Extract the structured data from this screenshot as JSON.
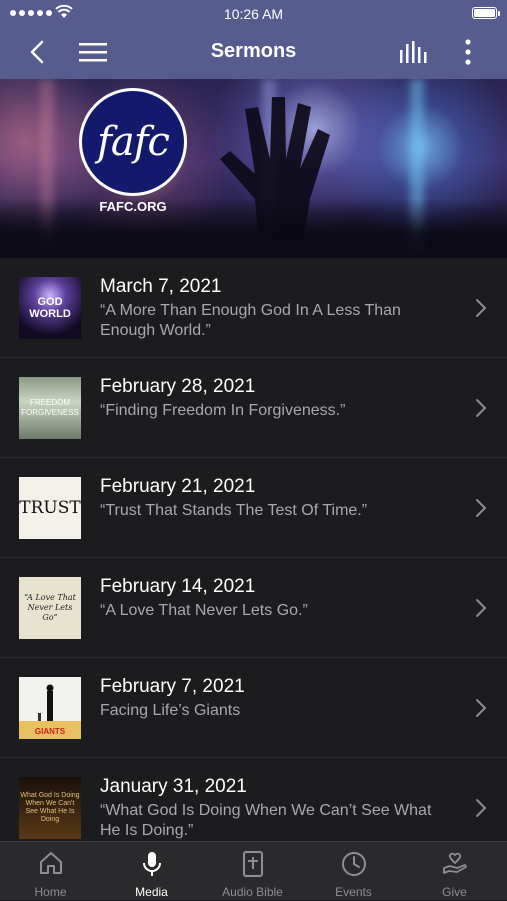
{
  "status_bar": {
    "time": "10:26 AM"
  },
  "nav": {
    "title": "Sermons",
    "back_icon": "chevron-left-icon",
    "menu_icon": "hamburger-icon",
    "audio_icon": "equalizer-icon",
    "more_icon": "vertical-ellipsis-icon"
  },
  "hero": {
    "logo_text": "fafc",
    "logo_url": "FAFC.ORG"
  },
  "sermons": [
    {
      "date": "March 7, 2021",
      "title": "“A More Than Enough God In A Less Than Enough World.”",
      "thumb_text": "GOD WORLD"
    },
    {
      "date": "February 28, 2021",
      "title": "“Finding Freedom In Forgiveness.”",
      "thumb_text": "FREEDOM FORGIVENESS"
    },
    {
      "date": "February 21, 2021",
      "title": "“Trust That Stands The Test Of Time.”",
      "thumb_text": "TRUST"
    },
    {
      "date": "February 14, 2021",
      "title": "“A Love That Never Lets Go.”",
      "thumb_text": "“A Love That Never Lets Go”"
    },
    {
      "date": "February 7, 2021",
      "title": "Facing Life’s Giants",
      "thumb_text": "GIANTS"
    },
    {
      "date": "January 31, 2021",
      "title": "“What God Is Doing When We Can’t See What He Is Doing.”",
      "thumb_text": "What God Is Doing When We Can't See What He Is Doing"
    }
  ],
  "tabs": [
    {
      "label": "Home",
      "icon": "home-icon"
    },
    {
      "label": "Media",
      "icon": "microphone-icon",
      "active": true
    },
    {
      "label": "Audio Bible",
      "icon": "bible-icon"
    },
    {
      "label": "Events",
      "icon": "clock-icon"
    },
    {
      "label": "Give",
      "icon": "hand-heart-icon"
    }
  ],
  "colors": {
    "header": "#575c8f",
    "background": "#1c1c1e",
    "tabbar": "#2a2a2c",
    "subtitle": "#a8a8ad"
  }
}
